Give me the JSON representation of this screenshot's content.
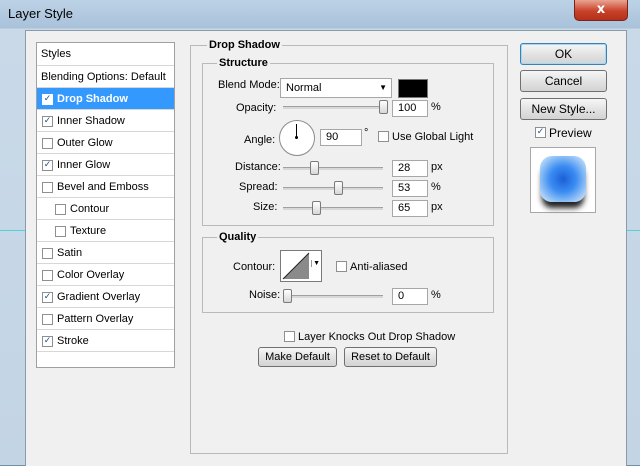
{
  "window": {
    "title": "Layer Style",
    "close_glyph": "x"
  },
  "styles_list": {
    "header": "Styles",
    "blending": "Blending Options: Default",
    "items": [
      {
        "label": "Drop Shadow",
        "checked": true,
        "selected": true,
        "indent": false
      },
      {
        "label": "Inner Shadow",
        "checked": true,
        "selected": false,
        "indent": false
      },
      {
        "label": "Outer Glow",
        "checked": false,
        "selected": false,
        "indent": false
      },
      {
        "label": "Inner Glow",
        "checked": true,
        "selected": false,
        "indent": false
      },
      {
        "label": "Bevel and Emboss",
        "checked": false,
        "selected": false,
        "indent": false
      },
      {
        "label": "Contour",
        "checked": false,
        "selected": false,
        "indent": true
      },
      {
        "label": "Texture",
        "checked": false,
        "selected": false,
        "indent": true
      },
      {
        "label": "Satin",
        "checked": false,
        "selected": false,
        "indent": false
      },
      {
        "label": "Color Overlay",
        "checked": false,
        "selected": false,
        "indent": false
      },
      {
        "label": "Gradient Overlay",
        "checked": true,
        "selected": false,
        "indent": false
      },
      {
        "label": "Pattern Overlay",
        "checked": false,
        "selected": false,
        "indent": false
      },
      {
        "label": "Stroke",
        "checked": true,
        "selected": false,
        "indent": false
      }
    ]
  },
  "drop_shadow": {
    "title": "Drop Shadow",
    "structure": {
      "title": "Structure",
      "blend_mode_label": "Blend Mode:",
      "blend_mode_value": "Normal",
      "shadow_color": "#000000",
      "opacity_label": "Opacity:",
      "opacity_value": "100",
      "opacity_unit": "%",
      "opacity_fraction": 1.0,
      "angle_label": "Angle:",
      "angle_value": "90",
      "angle_unit": "°",
      "angle_degrees": 90,
      "global_light_label": "Use Global Light",
      "global_light_checked": false,
      "distance_label": "Distance:",
      "distance_value": "28",
      "distance_unit": "px",
      "distance_fraction": 0.28,
      "spread_label": "Spread:",
      "spread_value": "53",
      "spread_unit": "%",
      "spread_fraction": 0.53,
      "size_label": "Size:",
      "size_value": "65",
      "size_unit": "px",
      "size_fraction": 0.3
    },
    "quality": {
      "title": "Quality",
      "contour_label": "Contour:",
      "anti_aliased_label": "Anti-aliased",
      "anti_aliased_checked": false,
      "noise_label": "Noise:",
      "noise_value": "0",
      "noise_unit": "%",
      "noise_fraction": 0.0
    },
    "knockout_label": "Layer Knocks Out Drop Shadow",
    "knockout_checked": false,
    "make_default_label": "Make Default",
    "reset_default_label": "Reset to Default"
  },
  "actions": {
    "ok_label": "OK",
    "cancel_label": "Cancel",
    "new_style_label": "New Style...",
    "preview_label": "Preview",
    "preview_checked": true
  },
  "icons": {
    "check": "✓",
    "dropdown": "▼",
    "close": "close-icon"
  }
}
